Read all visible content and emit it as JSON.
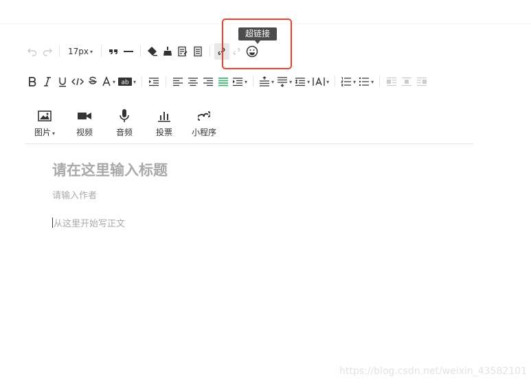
{
  "toolbar": {
    "font_size": "17px",
    "tooltip": "超链接"
  },
  "media": [
    {
      "label": "图片",
      "icon": "image-icon"
    },
    {
      "label": "视频",
      "icon": "video-icon"
    },
    {
      "label": "音频",
      "icon": "microphone-icon"
    },
    {
      "label": "投票",
      "icon": "poll-icon"
    },
    {
      "label": "小程序",
      "icon": "mini-program-icon"
    }
  ],
  "editor": {
    "title_placeholder": "请在这里输入标题",
    "author_placeholder": "请输入作者",
    "body_placeholder": "从这里开始写正文"
  },
  "watermark": "https://blog.csdn.net/weixin_43582101",
  "colors": {
    "highlight_box": "#e8402c",
    "tooltip_bg": "#4c4c4c",
    "justify_active": "#3cb371"
  }
}
